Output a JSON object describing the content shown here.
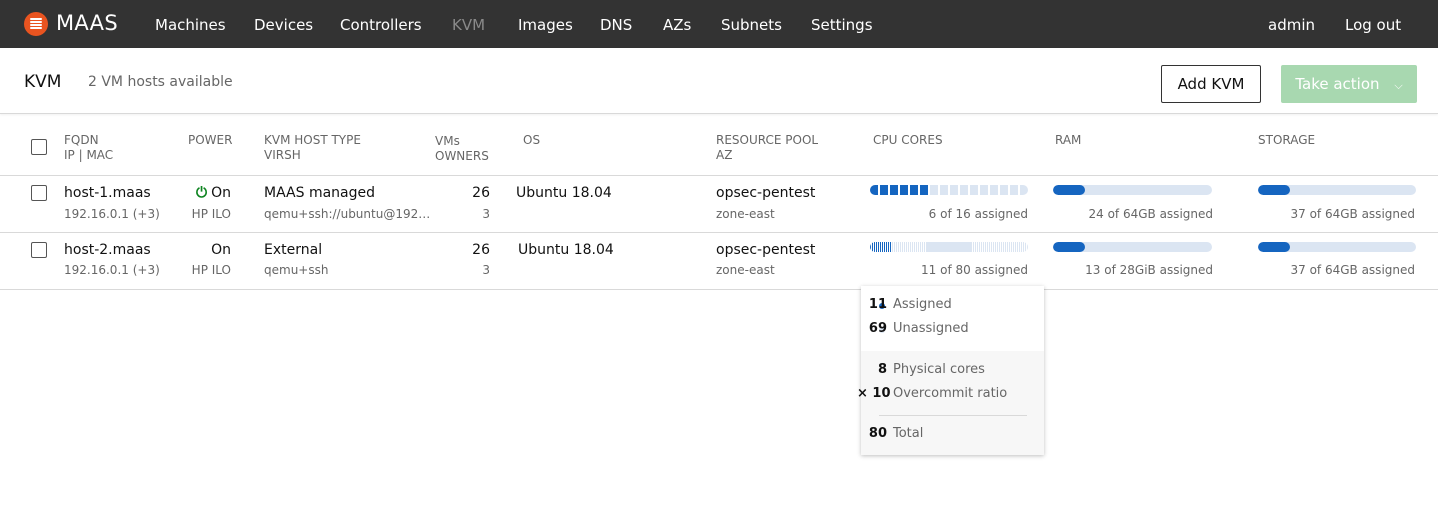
{
  "app": {
    "name": "MAAS"
  },
  "nav": {
    "items": [
      {
        "label": "Machines"
      },
      {
        "label": "Devices"
      },
      {
        "label": "Controllers"
      },
      {
        "label": "KVM"
      },
      {
        "label": "Images"
      },
      {
        "label": "DNS"
      },
      {
        "label": "AZs"
      },
      {
        "label": "Subnets"
      },
      {
        "label": "Settings"
      }
    ],
    "active": "KVM",
    "user": "admin",
    "logout": "Log out"
  },
  "header": {
    "title": "KVM",
    "subtitle": "2 VM hosts available",
    "add_button": "Add KVM",
    "action_button": "Take action"
  },
  "table": {
    "columns": {
      "fqdn": "FQDN",
      "ipmac": "IP | MAC",
      "power": "POWER",
      "type": "KVM HOST TYPE",
      "virsh": "VIRSH",
      "vms": "VMs",
      "owners": "OWNERS",
      "os": "OS",
      "pool": "RESOURCE POOL",
      "az": "AZ",
      "cpu": "CPU CORES",
      "ram": "RAM",
      "storage": "STORAGE"
    },
    "rows": [
      {
        "fqdn": "host-1.maas",
        "ip": "192.16.0.1 (+3)",
        "power": "On",
        "power_type": "HP ILO",
        "type": "MAAS managed",
        "virsh": "qemu+ssh://ubuntu@192…",
        "vms": "26",
        "owners": "3",
        "os": "Ubuntu 18.04",
        "pool": "opsec-pentest",
        "az": "zone-east",
        "cpu_text": "6 of 16 assigned",
        "cpu_assigned": 6,
        "cpu_total": 16,
        "ram_text": "24 of 64GB assigned",
        "ram_fraction": 0.2,
        "storage_text": "37 of 64GB assigned",
        "storage_fraction": 0.2
      },
      {
        "fqdn": "host-2.maas",
        "ip": "192.16.0.1 (+3)",
        "power": "On",
        "power_type": "HP ILO",
        "type": "External",
        "virsh": "qemu+ssh",
        "vms": "26",
        "owners": "3",
        "os": "Ubuntu 18.04",
        "pool": "opsec-pentest",
        "az": "zone-east",
        "cpu_text": "11 of 80 assigned",
        "cpu_assigned": 11,
        "cpu_total": 80,
        "ram_text": "13 of 28GiB assigned",
        "ram_fraction": 0.2,
        "storage_text": "37 of 64GB assigned",
        "storage_fraction": 0.2
      }
    ]
  },
  "tooltip": {
    "assigned_value": "11",
    "assigned_label": "Assigned",
    "unassigned_value": "69",
    "unassigned_label": "Unassigned",
    "physical_value": "8",
    "physical_label": "Physical cores",
    "overcommit_value": "× 10",
    "overcommit_label": "Overcommit ratio",
    "total_value": "80",
    "total_label": "Total"
  },
  "colors": {
    "accent": "#e95420",
    "bar": "#1565c0",
    "bar_track": "#dbe5f2",
    "power_on": "#0e8420",
    "nav_bg": "#333333",
    "action": "#a8d8b0"
  }
}
